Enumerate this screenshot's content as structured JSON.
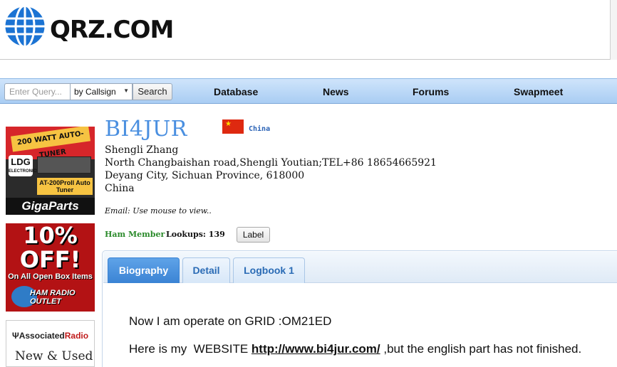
{
  "header": {
    "logo_text": "QRZ.COM"
  },
  "navbar": {
    "search_placeholder": "Enter Query...",
    "search_mode": "by Callsign",
    "search_button": "Search",
    "links": [
      "Database",
      "News",
      "Forums",
      "Swapmeet"
    ]
  },
  "ads": {
    "ad1_banner": "200 WATT AUTO-TUNER",
    "ad1_ldg": "LDG",
    "ad1_ldg_sub": "ELECTRONICS",
    "ad1_model": "AT-200ProII Auto Tuner",
    "ad1_brand": "GigaParts",
    "ad2_big1": "10%",
    "ad2_big2": "OFF!",
    "ad2_sub": "On All Open Box Items",
    "ad2_brand": "HAM RADIO OUTLET",
    "ad3_brand_a": "Associated",
    "ad3_brand_b": "Radio",
    "ad3_sub": "New & Used"
  },
  "profile": {
    "callsign": "BI4JUR",
    "country": "China",
    "name": "Shengli Zhang",
    "address1": "North Changbaishan road,Shengli Youtian;TEL+86 18654665921",
    "address2": "Deyang City, Sichuan Province, 618000",
    "address3": "China",
    "email_note": "Email: Use mouse to view..",
    "member_type": "Ham Member",
    "lookups": "Lookups: 139",
    "label_button": "Label"
  },
  "tabs": [
    "Biography",
    "Detail",
    "Logbook 1"
  ],
  "active_tab": "Biography",
  "biography": {
    "line1": "Now I am operate on GRID :OM21ED",
    "line2_prefix": "Here is my  WEBSITE ",
    "line2_link": "http://www.bi4jur.com/",
    "line2_suffix": " ,but the english part has not finished."
  },
  "colors": {
    "callsign": "#4a8fe0",
    "navbar": "#a9cdf3",
    "active_tab": "#3a83d4",
    "member": "#2a8a2a"
  }
}
